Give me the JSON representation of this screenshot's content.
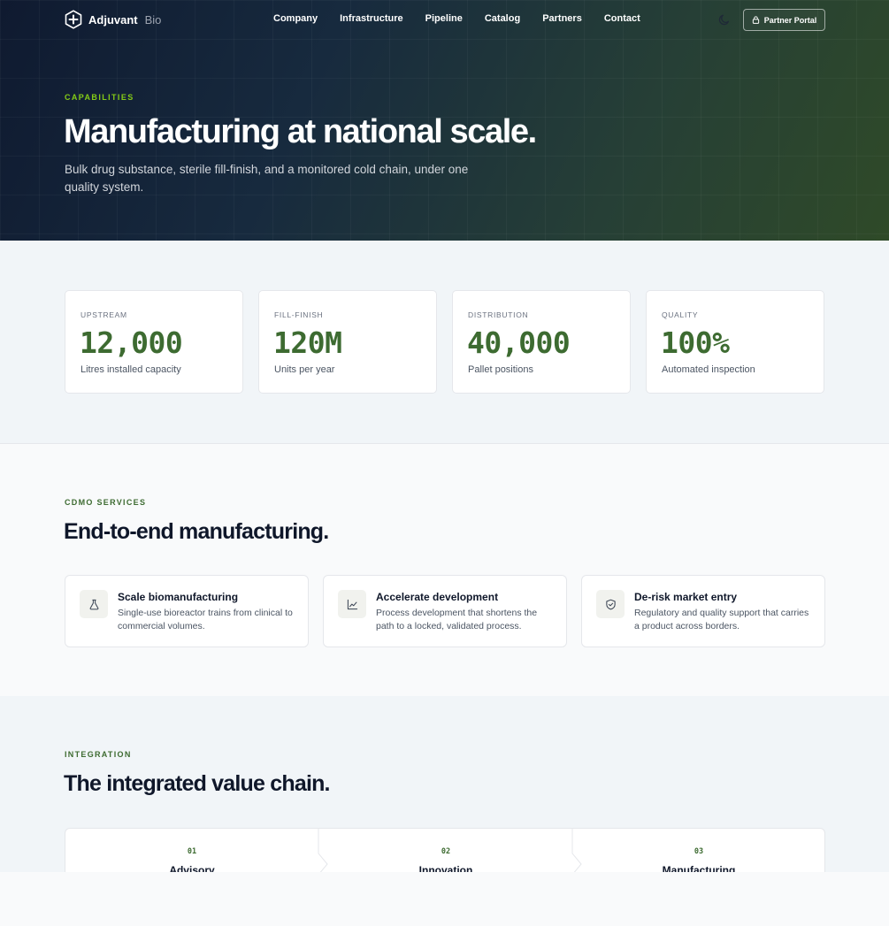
{
  "colors": {
    "accent": "#3d6b31",
    "eyebrow_hero": "#84cc16",
    "navy": "#0f1a30"
  },
  "nav": {
    "brand_name": "Adjuvant",
    "brand_sub": "Bio",
    "logo_icon": "hexagon-cross-icon",
    "links": [
      "Company",
      "Infrastructure",
      "Pipeline",
      "Catalog",
      "Partners",
      "Contact"
    ],
    "theme_icon": "moon-icon",
    "portal_label": "Partner Portal",
    "portal_icon": "lock-icon"
  },
  "hero": {
    "eyebrow": "CAPABILITIES",
    "title": "Manufacturing at national scale.",
    "description": "Bulk drug substance, sterile fill-finish, and a monitored cold chain, under one quality system."
  },
  "stats": [
    {
      "label": "UPSTREAM",
      "value": "12,000",
      "caption": "Litres installed capacity"
    },
    {
      "label": "FILL-FINISH",
      "value": "120M",
      "caption": "Units per year"
    },
    {
      "label": "DISTRIBUTION",
      "value": "40,000",
      "caption": "Pallet positions"
    },
    {
      "label": "QUALITY",
      "value": "100%",
      "caption": "Automated inspection"
    }
  ],
  "services": {
    "eyebrow": "CDMO SERVICES",
    "title": "End-to-end manufacturing.",
    "items": [
      {
        "icon": "flask-icon",
        "title": "Scale biomanufacturing",
        "description": "Single-use bioreactor trains from clinical to commercial volumes."
      },
      {
        "icon": "line-chart-icon",
        "title": "Accelerate development",
        "description": "Process development that shortens the path to a locked, validated process."
      },
      {
        "icon": "shield-check-icon",
        "title": "De-risk market entry",
        "description": "Regulatory and quality support that carries a product across borders."
      }
    ]
  },
  "integration": {
    "eyebrow": "INTEGRATION",
    "title": "The integrated value chain.",
    "steps": [
      {
        "number": "01",
        "name": "Advisory"
      },
      {
        "number": "02",
        "name": "Innovation"
      },
      {
        "number": "03",
        "name": "Manufacturing"
      }
    ]
  }
}
